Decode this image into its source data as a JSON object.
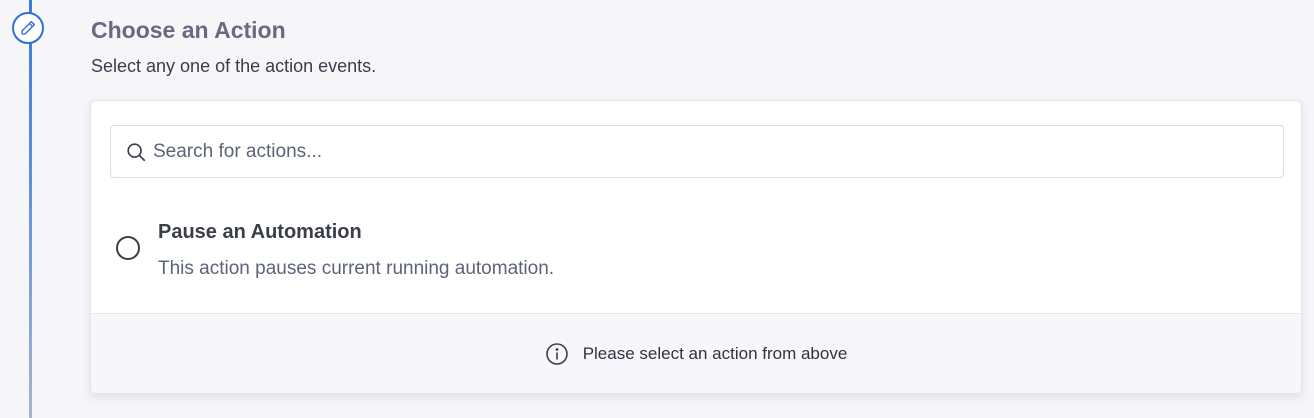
{
  "step": {
    "icon": "pencil-icon",
    "title": "Choose an Action",
    "subtitle": "Select any one of the action events."
  },
  "search": {
    "icon": "search-icon",
    "value": "",
    "placeholder": "Search for actions..."
  },
  "actions": [
    {
      "title": "Pause an Automation",
      "description": "This action pauses current running automation.",
      "selected": false
    }
  ],
  "footer": {
    "icon": "info-icon",
    "message": "Please select an action from above"
  },
  "colors": {
    "accent": "#2f6fd6",
    "title": "#676a80",
    "muted": "#5d6478",
    "background": "#f6f6f9"
  }
}
